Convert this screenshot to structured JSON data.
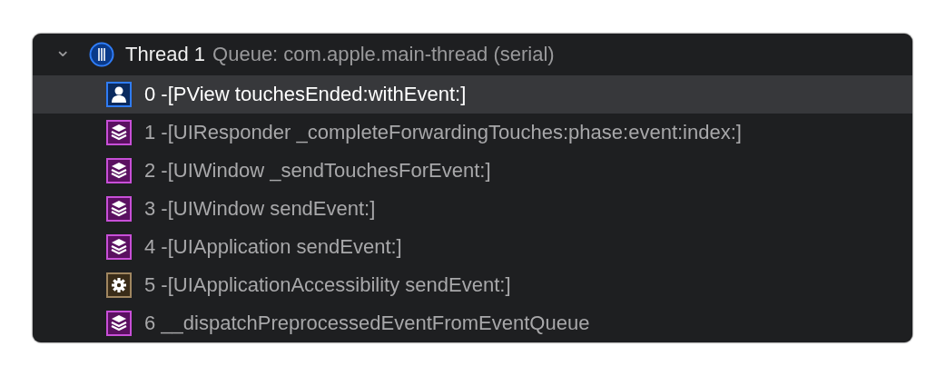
{
  "thread": {
    "chevron": "⌄",
    "expanded": true,
    "name": "Thread 1",
    "queue": "Queue: com.apple.main-thread (serial)"
  },
  "frames": [
    {
      "kind": "user",
      "label": "0 -[PView touchesEnded:withEvent:]",
      "selected": true
    },
    {
      "kind": "library",
      "label": "1 -[UIResponder _completeForwardingTouches:phase:event:index:]",
      "selected": false
    },
    {
      "kind": "library",
      "label": "2 -[UIWindow _sendTouchesForEvent:]",
      "selected": false
    },
    {
      "kind": "library",
      "label": "3 -[UIWindow sendEvent:]",
      "selected": false
    },
    {
      "kind": "library",
      "label": "4 -[UIApplication sendEvent:]",
      "selected": false
    },
    {
      "kind": "system",
      "label": "5 -[UIApplicationAccessibility sendEvent:]",
      "selected": false
    },
    {
      "kind": "library",
      "label": "6 __dispatchPreprocessedEventFromEventQueue",
      "selected": false
    }
  ]
}
